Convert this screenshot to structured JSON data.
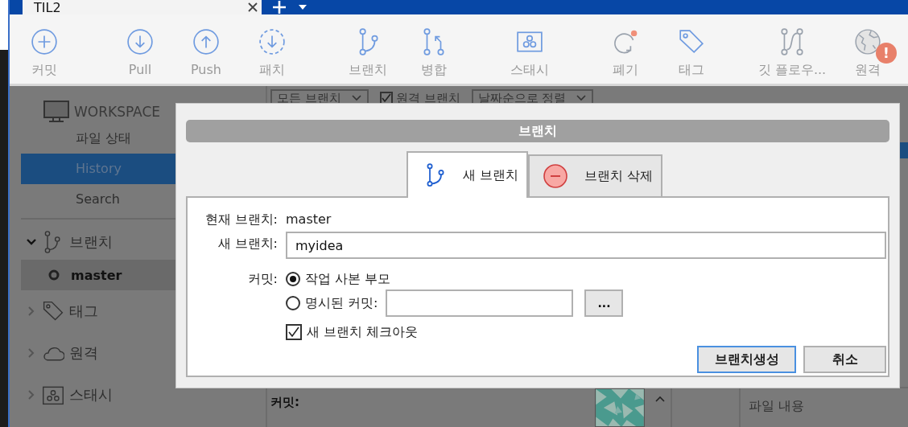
{
  "window_tabs": [
    {
      "label": "TIL2",
      "selected": true
    }
  ],
  "toolbar": [
    [
      {
        "label": "커밋",
        "kind": "commit"
      }
    ],
    [
      {
        "label": "Pull",
        "kind": "pull"
      },
      {
        "label": "Push",
        "kind": "push"
      },
      {
        "label": "패치",
        "kind": "patch"
      }
    ],
    [
      {
        "label": "브랜치",
        "kind": "branch"
      },
      {
        "label": "병합",
        "kind": "merge"
      }
    ],
    [
      {
        "label": "스태시",
        "kind": "stash"
      }
    ],
    [
      {
        "label": "폐기",
        "kind": "discard"
      },
      {
        "label": "태그",
        "kind": "tag"
      }
    ],
    [
      {
        "label": "깃 플로우...",
        "kind": "gitflow"
      },
      {
        "label": "원격",
        "kind": "remote",
        "badge": "!"
      }
    ]
  ],
  "sidebar": {
    "workspace": {
      "title": "WORKSPACE",
      "items": [
        {
          "label": "파일 상태",
          "selected": false
        },
        {
          "label": "History",
          "selected": true
        },
        {
          "label": "Search",
          "selected": false
        }
      ]
    },
    "groups": [
      {
        "label": "브랜치",
        "kind": "branch",
        "expanded": true,
        "children": [
          {
            "label": "master",
            "selected": true
          }
        ]
      },
      {
        "label": "태그",
        "kind": "tag",
        "expanded": false
      },
      {
        "label": "원격",
        "kind": "remote",
        "expanded": false
      },
      {
        "label": "스태시",
        "kind": "stash",
        "expanded": false
      }
    ]
  },
  "filter_bar": {
    "branch_filter": "모든 브랜치",
    "remote_branches": {
      "label": "원격 브랜치",
      "checked": true
    },
    "sort": "날짜순으로 정렬"
  },
  "commit_panel": {
    "label": "커밋:"
  },
  "file_panel": {
    "column": "파일 내용"
  },
  "dialog": {
    "title": "브랜치",
    "tabs": [
      {
        "label": "새 브랜치",
        "kind": "new",
        "selected": true
      },
      {
        "label": "브랜치 삭제",
        "kind": "delete",
        "selected": false
      }
    ],
    "current_branch": {
      "label": "현재 브랜치:",
      "value": "master"
    },
    "new_branch": {
      "label": "새 브랜치:",
      "value": "myidea"
    },
    "commit": {
      "label": "커밋:",
      "options": [
        {
          "label": "작업 사본 부모",
          "selected": true
        },
        {
          "label": "명시된 커밋:",
          "selected": false
        }
      ],
      "browse_button": "..."
    },
    "checkout": {
      "label": "새 브랜치 체크아웃",
      "checked": true
    },
    "buttons": [
      {
        "label": "브랜치생성",
        "primary": true
      },
      {
        "label": "취소",
        "primary": false
      }
    ]
  }
}
